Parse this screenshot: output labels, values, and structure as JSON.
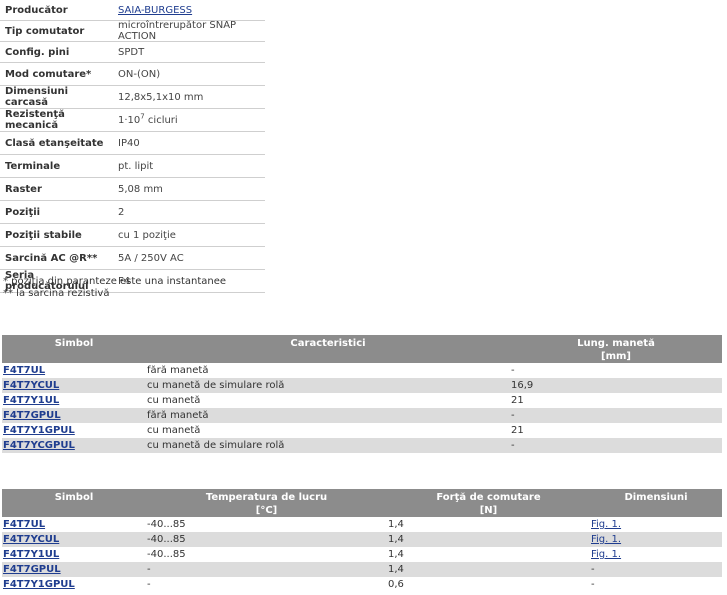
{
  "specs": [
    {
      "label": "Producător",
      "value": "SAIA-BURGESS",
      "link": true
    },
    {
      "label": "Tip comutator",
      "value": "microîntrerupător SNAP ACTION"
    },
    {
      "label": "Config. pini",
      "value": "SPDT"
    },
    {
      "label": "Mod comutare*",
      "value": "ON-(ON)"
    },
    {
      "label": "Dimensiuni carcasă",
      "value": "12,8x5,1x10 mm"
    },
    {
      "label": "Rezistenţă mecanică",
      "value_pre": "1·10",
      "value_sup": "7",
      "value_post": " cicluri"
    },
    {
      "label": "Clasă etanşeitate",
      "value": "IP40"
    },
    {
      "label": "Terminale",
      "value": "pt. lipit"
    },
    {
      "label": "Raster",
      "value": "5,08 mm"
    },
    {
      "label": "Poziţii",
      "value": "2"
    },
    {
      "label": "Poziţii stabile",
      "value": "cu 1 poziţie"
    },
    {
      "label": "Sarcină AC @R**",
      "value": "5A / 250V AC"
    },
    {
      "label": "Seria producătorului",
      "value": "F4"
    }
  ],
  "notes": {
    "note1": "* poziţia din paranteze este una instantanee",
    "note2": "** la sarcina rezistivă"
  },
  "table1": {
    "headers": {
      "symbol": "Simbol",
      "characteristics": "Caracteristici",
      "length_line1": "Lung. manetă",
      "length_line2": "[mm]"
    },
    "rows": [
      {
        "symbol": "F4T7UL",
        "characteristics": "fără manetă",
        "length": "-"
      },
      {
        "symbol": "F4T7YCUL",
        "characteristics": "cu manetă de simulare rolă",
        "length": "16,9"
      },
      {
        "symbol": "F4T7Y1UL",
        "characteristics": "cu manetă",
        "length": "21"
      },
      {
        "symbol": "F4T7GPUL",
        "characteristics": "fără manetă",
        "length": "-"
      },
      {
        "symbol": "F4T7Y1GPUL",
        "characteristics": "cu manetă",
        "length": "21"
      },
      {
        "symbol": "F4T7YCGPUL",
        "characteristics": "cu manetă de simulare rolă",
        "length": "-"
      }
    ]
  },
  "table2": {
    "headers": {
      "symbol": "Simbol",
      "temperature_line1": "Temperatura de lucru",
      "temperature_line2": "[°C]",
      "force_line1": "Forţă de comutare",
      "force_line2": "[N]",
      "dimensions": "Dimensiuni"
    },
    "rows": [
      {
        "symbol": "F4T7UL",
        "temperature": "-40...85",
        "force": "1,4",
        "dimensions": "Fig. 1."
      },
      {
        "symbol": "F4T7YCUL",
        "temperature": "-40...85",
        "force": "1,4",
        "dimensions": "Fig. 1."
      },
      {
        "symbol": "F4T7Y1UL",
        "temperature": "-40...85",
        "force": "1,4",
        "dimensions": "Fig. 1."
      },
      {
        "symbol": "F4T7GPUL",
        "temperature": "-",
        "force": "1,4",
        "dimensions": "-"
      },
      {
        "symbol": "F4T7Y1GPUL",
        "temperature": "-",
        "force": "0,6",
        "dimensions": "-"
      }
    ]
  }
}
